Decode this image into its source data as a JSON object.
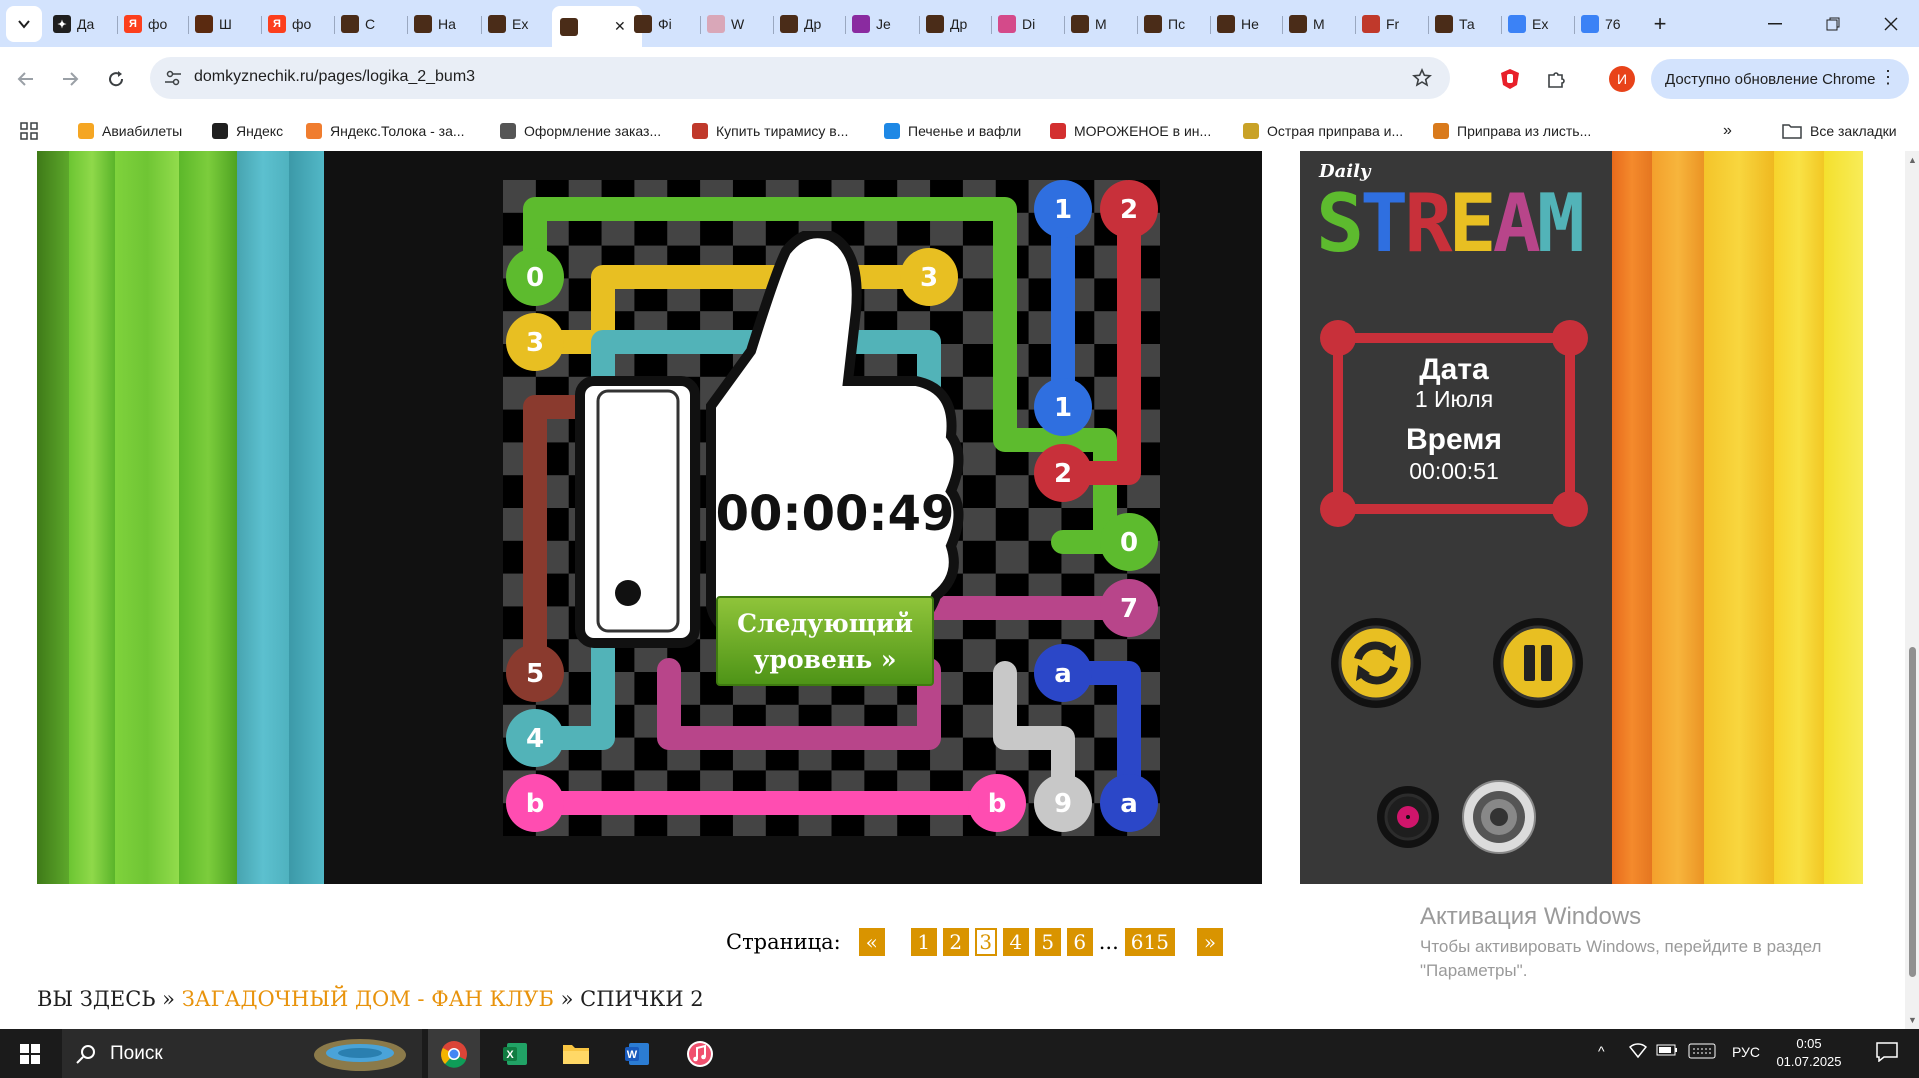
{
  "browser": {
    "tabs": [
      {
        "title": "Да",
        "color": "#1f1f1f",
        "glyph": "✦"
      },
      {
        "title": "фо",
        "color": "#fc3f1d",
        "glyph": "Я"
      },
      {
        "title": "Ш",
        "color": "#5a2a10",
        "glyph": ""
      },
      {
        "title": "фо",
        "color": "#fc3f1d",
        "glyph": "Я"
      },
      {
        "title": "С",
        "color": "#4a2c18",
        "glyph": ""
      },
      {
        "title": "На",
        "color": "#4a2c18",
        "glyph": ""
      },
      {
        "title": "Ex",
        "color": "#4a2c18",
        "glyph": ""
      },
      {
        "title": "",
        "color": "#4a2c18",
        "glyph": ""
      },
      {
        "title": "Фі",
        "color": "#4a2c18",
        "glyph": ""
      },
      {
        "title": "W",
        "color": "#d9a7b8",
        "glyph": ""
      },
      {
        "title": "Др",
        "color": "#4a2c18",
        "glyph": ""
      },
      {
        "title": "Je",
        "color": "#8a2ba0",
        "glyph": ""
      },
      {
        "title": "Др",
        "color": "#4a2c18",
        "glyph": ""
      },
      {
        "title": "Di",
        "color": "#d44a8a",
        "glyph": ""
      },
      {
        "title": "M",
        "color": "#4a2c18",
        "glyph": ""
      },
      {
        "title": "Пс",
        "color": "#4a2c18",
        "glyph": ""
      },
      {
        "title": "Не",
        "color": "#4a2c18",
        "glyph": ""
      },
      {
        "title": "M",
        "color": "#4a2c18",
        "glyph": ""
      },
      {
        "title": "Fr",
        "color": "#c0392b",
        "glyph": ""
      },
      {
        "title": "Та",
        "color": "#4a2c18",
        "glyph": ""
      },
      {
        "title": "Ex",
        "color": "#3b82f6",
        "glyph": ""
      },
      {
        "title": "76",
        "color": "#3b82f6",
        "glyph": ""
      }
    ],
    "new_tab": "+",
    "url": "domkyznechik.ru/pages/logika_2_bum3",
    "profile_initial": "И",
    "update_label": "Доступно обновление Chrome",
    "bookmarks": [
      {
        "label": "Авиабилеты",
        "color": "#f5a623"
      },
      {
        "label": "Яндекс",
        "color": "#1f1f1f"
      },
      {
        "label": "Яндекс.Толока - за...",
        "color": "#f07d2f"
      },
      {
        "label": "Оформление заказ...",
        "color": "#555555"
      },
      {
        "label": "Купить тирамису в...",
        "color": "#c0392b"
      },
      {
        "label": "Печенье и вафли",
        "color": "#1e88e5"
      },
      {
        "label": "МОРОЖЕНОЕ в ин...",
        "color": "#d32f2f"
      },
      {
        "label": "Острая приправа и...",
        "color": "#c9a227"
      },
      {
        "label": "Приправа из листь...",
        "color": "#d97a1c"
      }
    ],
    "all_bookmarks": "Все закладки"
  },
  "game": {
    "logo_small": "Daily",
    "logo_big": "STREAM",
    "date_label": "Дата",
    "date_value": "1 Июля",
    "time_label": "Время",
    "time_value": "00:00:51",
    "overlay_time": "00:00:49",
    "next_level_line1": "Следующий",
    "next_level_line2": "уровень »",
    "dots": [
      {
        "label": "1",
        "color": "#2f6fe0"
      },
      {
        "label": "2",
        "color": "#c8303a"
      },
      {
        "label": "0",
        "color": "#5dbb2e"
      },
      {
        "label": "3",
        "color": "#e8bf22"
      },
      {
        "label": "3",
        "color": "#e8bf22"
      },
      {
        "label": "5",
        "color": "#8a3a2e"
      },
      {
        "label": "1",
        "color": "#2f6fe0"
      },
      {
        "label": "2",
        "color": "#c8303a"
      },
      {
        "label": "0",
        "color": "#5dbb2e"
      },
      {
        "label": "7",
        "color": "#b8458a"
      },
      {
        "label": "5",
        "color": "#8a3a2e"
      },
      {
        "label": "a",
        "color": "#2b47c8"
      },
      {
        "label": "4",
        "color": "#52b3b8"
      },
      {
        "label": "b",
        "color": "#ff4db1"
      },
      {
        "label": "b",
        "color": "#ff4db1"
      },
      {
        "label": "9",
        "color": "#c8c8c8"
      },
      {
        "label": "a",
        "color": "#2b47c8"
      }
    ]
  },
  "pager": {
    "label": "Страница:",
    "prev": "«",
    "pages": [
      "1",
      "2",
      "3",
      "4",
      "5",
      "6"
    ],
    "current": "3",
    "ellipsis": "...",
    "last": "615",
    "next": "»"
  },
  "breadcrumb": {
    "prefix": "ВЫ ЗДЕСЬ »",
    "link": "ЗАГАДОЧНЫЙ ДОМ - ФАН КЛУБ",
    "current": "» СПИЧКИ 2"
  },
  "watermark": {
    "title": "Активация Windows",
    "line1": "Чтобы активировать Windows, перейдите в раздел",
    "line2": "\"Параметры\"."
  },
  "taskbar": {
    "search": "Поиск",
    "lang": "РУС",
    "time": "0:05",
    "date": "01.07.2025"
  }
}
